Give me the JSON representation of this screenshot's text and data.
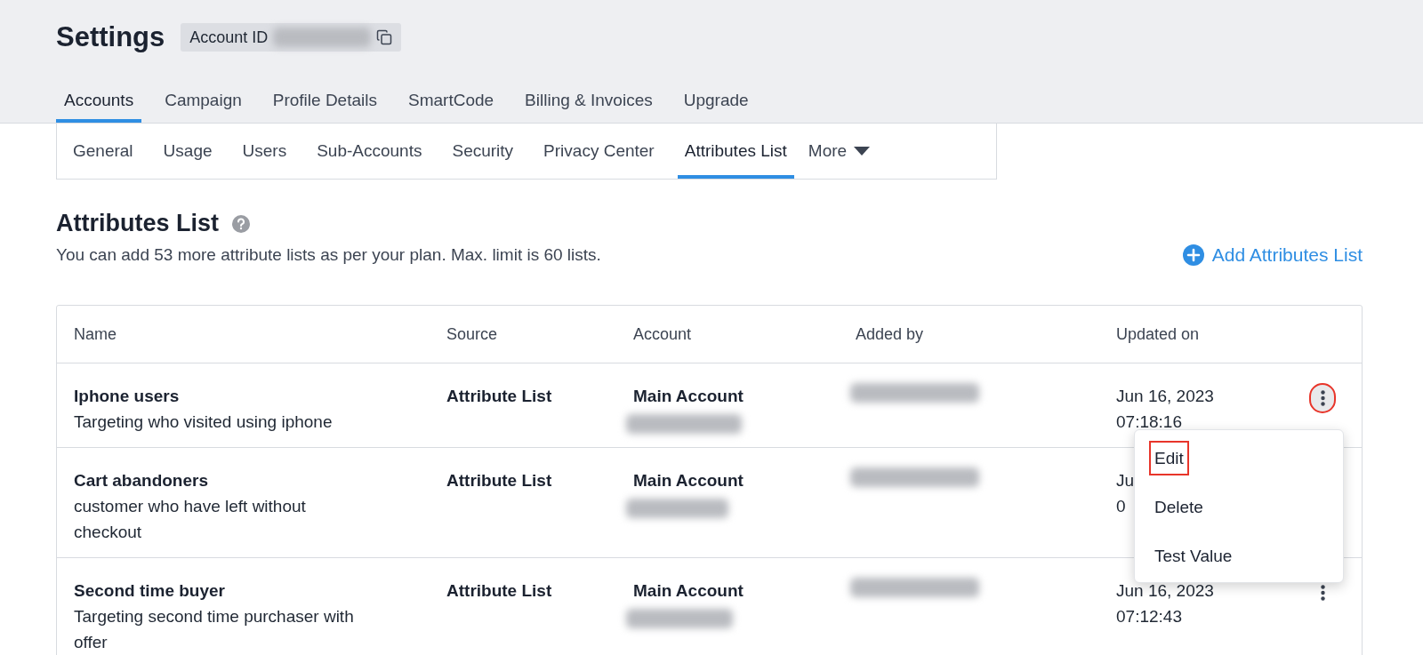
{
  "header": {
    "title": "Settings",
    "account_id_label": "Account ID"
  },
  "tabs": [
    {
      "label": "Accounts",
      "selected": true
    },
    {
      "label": "Campaign",
      "selected": false
    },
    {
      "label": "Profile Details",
      "selected": false
    },
    {
      "label": "SmartCode",
      "selected": false
    },
    {
      "label": "Billing & Invoices",
      "selected": false
    },
    {
      "label": "Upgrade",
      "selected": false
    }
  ],
  "subtabs": [
    {
      "label": "General",
      "selected": false,
      "kind": "tab"
    },
    {
      "label": "Usage",
      "selected": false,
      "kind": "tab"
    },
    {
      "label": "Users",
      "selected": false,
      "kind": "tab"
    },
    {
      "label": "Sub-Accounts",
      "selected": false,
      "kind": "tab"
    },
    {
      "label": "Security",
      "selected": false,
      "kind": "tab"
    },
    {
      "label": "Privacy Center",
      "selected": false,
      "kind": "tab"
    },
    {
      "label": "Attributes List",
      "selected": true,
      "kind": "tab"
    },
    {
      "label": "More",
      "selected": false,
      "kind": "dropdown"
    }
  ],
  "section": {
    "title": "Attributes List",
    "description": "You can add 53 more attribute lists as per your plan. Max. limit is 60 lists.",
    "add_button": "Add Attributes List"
  },
  "table": {
    "columns": [
      "Name",
      "Source",
      "Account",
      "Added by",
      "Updated on"
    ],
    "rows": [
      {
        "name": "Iphone users",
        "description": "Targeting who visited using iphone",
        "source": "Attribute List",
        "account": "Main Account",
        "updated_date": "Jun 16, 2023",
        "updated_time": "07:18:16",
        "menu_open": true,
        "highlighted": true
      },
      {
        "name": "Cart abandoners",
        "description": "customer who have left without checkout",
        "source": "Attribute List",
        "account": "Main Account",
        "updated_date": "Ju",
        "updated_time": "0"
      },
      {
        "name": "Second time buyer",
        "description": "Targeting second time purchaser with offer",
        "source": "Attribute List",
        "account": "Main Account",
        "updated_date": "Jun 16, 2023",
        "updated_time": "07:12:43",
        "menu_open": false,
        "highlighted": false
      }
    ]
  },
  "menu": {
    "items": [
      {
        "label": "Edit",
        "highlighted": true
      },
      {
        "label": "Delete",
        "highlighted": false
      },
      {
        "label": "Test Value",
        "highlighted": false
      }
    ]
  }
}
